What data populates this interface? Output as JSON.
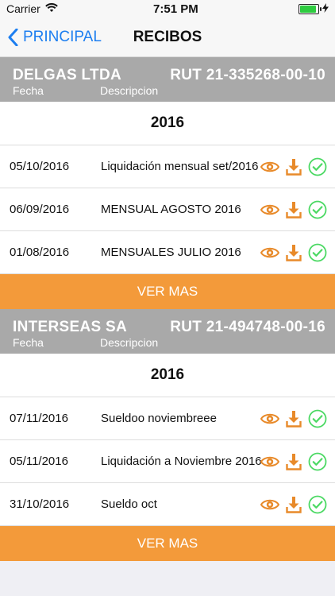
{
  "status": {
    "carrier": "Carrier",
    "time": "7:51 PM",
    "battery_level": 0.9
  },
  "nav": {
    "back_label": "PRINCIPAL",
    "title": "RECIBOS"
  },
  "companies": [
    {
      "name": "DELGAS LTDA",
      "rut": "RUT  21-335268-00-10",
      "col_fecha": "Fecha",
      "col_desc": "Descripcion",
      "year": "2016",
      "rows": [
        {
          "date": "05/10/2016",
          "desc": "Liquidación mensual set/2016"
        },
        {
          "date": "06/09/2016",
          "desc": "MENSUAL AGOSTO 2016"
        },
        {
          "date": "01/08/2016",
          "desc": "MENSUALES JULIO 2016"
        }
      ],
      "ver_mas": "VER MAS"
    },
    {
      "name": "INTERSEAS SA",
      "rut": "RUT  21-494748-00-16",
      "col_fecha": "Fecha",
      "col_desc": "Descripcion",
      "year": "2016",
      "rows": [
        {
          "date": "07/11/2016",
          "desc": "Sueldoo noviembreee"
        },
        {
          "date": "05/11/2016",
          "desc": "Liquidación a Noviembre 2016"
        },
        {
          "date": "31/10/2016",
          "desc": "Sueldo oct"
        }
      ],
      "ver_mas": "VER MAS"
    }
  ],
  "icons": {
    "view": "eye-icon",
    "download": "download-icon",
    "status": "check-circle-icon"
  },
  "colors": {
    "accent": "#f39a3a",
    "check": "#4cd964",
    "link": "#1c7ef0",
    "header_bg": "#a9a9a9"
  }
}
